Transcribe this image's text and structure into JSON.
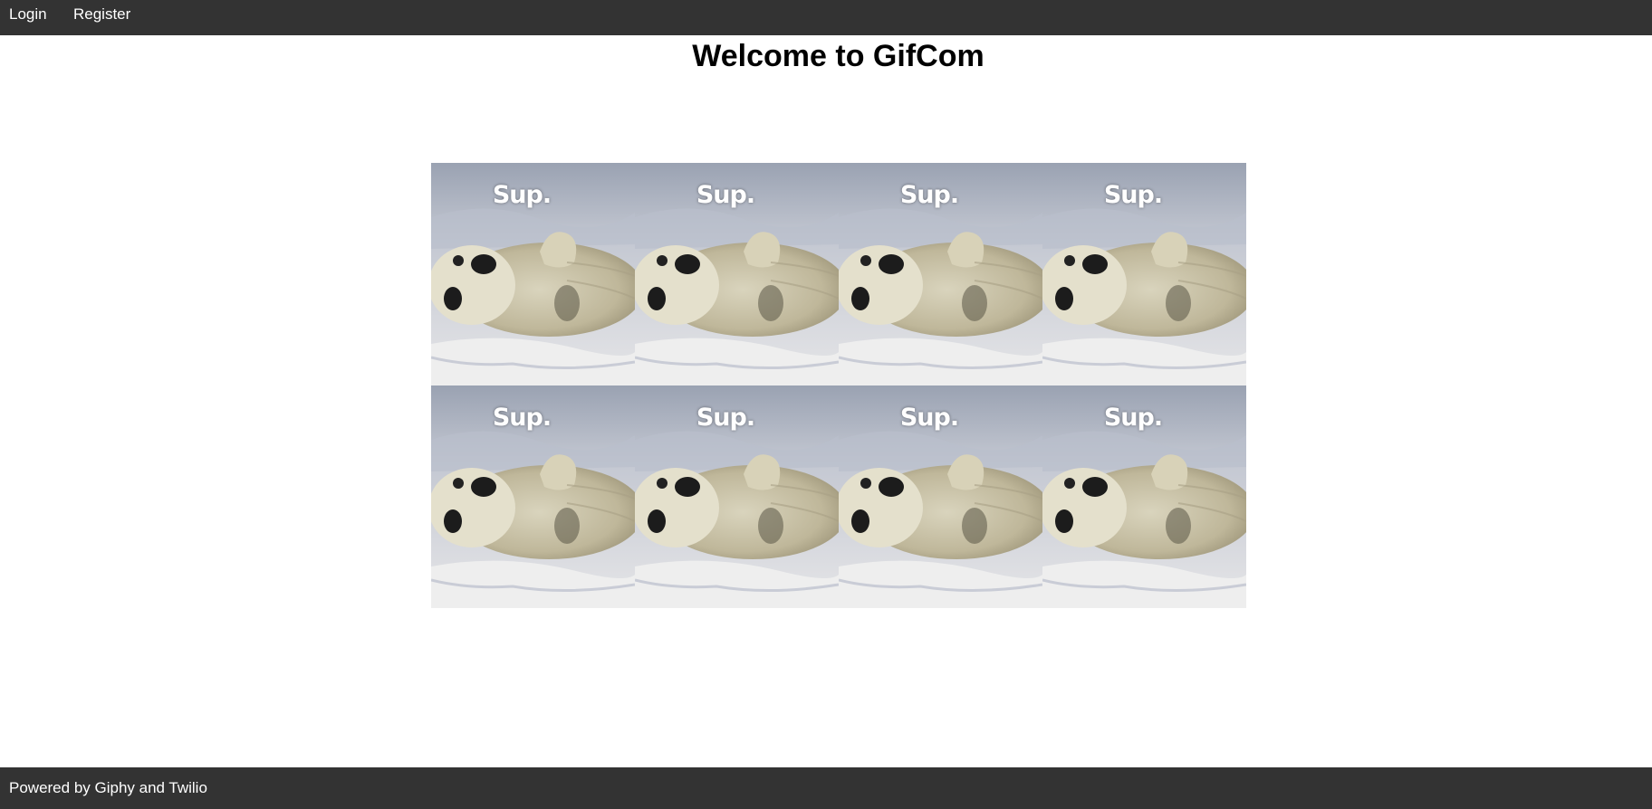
{
  "nav": {
    "login_label": "Login",
    "register_label": "Register"
  },
  "header": {
    "title": "Welcome to GifCom"
  },
  "gifs": [
    {
      "caption": "Sup."
    },
    {
      "caption": "Sup."
    },
    {
      "caption": "Sup."
    },
    {
      "caption": "Sup."
    },
    {
      "caption": "Sup."
    },
    {
      "caption": "Sup."
    },
    {
      "caption": "Sup."
    },
    {
      "caption": "Sup."
    }
  ],
  "footer": {
    "text": "Powered by Giphy and Twilio"
  },
  "colors": {
    "bar_background": "#333333",
    "page_background": "#ffffff"
  }
}
